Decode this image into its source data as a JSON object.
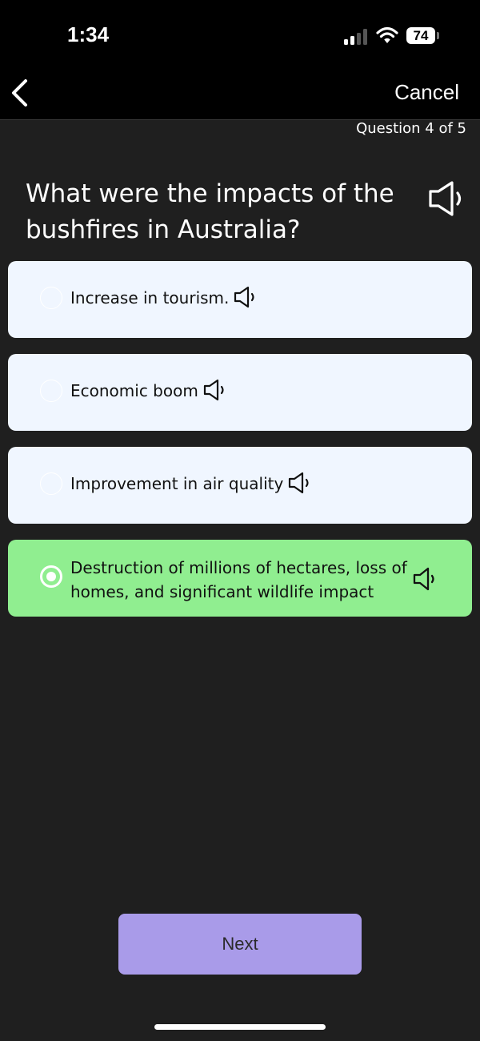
{
  "status_bar": {
    "time": "1:34",
    "battery": "74",
    "icons": [
      "signal-icon",
      "wifi-icon",
      "battery-icon"
    ]
  },
  "nav": {
    "back_icon": "chevron-left-icon",
    "cancel_label": "Cancel"
  },
  "quiz": {
    "counter": "Question 4 of 5",
    "question": "What were the impacts of the bushfires in Australia?",
    "options": [
      {
        "label": "Increase in tourism.",
        "selected": false
      },
      {
        "label": "Economic boom",
        "selected": false
      },
      {
        "label": "Improvement in air quality",
        "selected": false
      },
      {
        "label": "Destruction of millions of hectares, loss of homes, and significant wildlife impact",
        "selected": true
      }
    ],
    "next_label": "Next"
  },
  "colors": {
    "background": "#1f1f1f",
    "option_background": "#f0f6ff",
    "selected_option": "#90ee90",
    "next_button": "#a99be9"
  }
}
